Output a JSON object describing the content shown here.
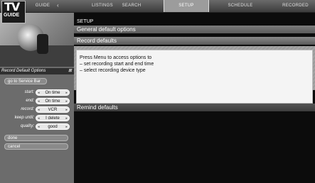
{
  "brand": {
    "logo_top": "TV",
    "logo_bottom": "GUIDE"
  },
  "nav": {
    "items": [
      {
        "label": "Guide"
      },
      {
        "label": "Listings"
      },
      {
        "label": "Search"
      },
      {
        "label": "Setup"
      },
      {
        "label": "Schedule"
      },
      {
        "label": "Recorded"
      }
    ],
    "active": "Setup"
  },
  "preview": {
    "channel_indicator": ""
  },
  "side_panel": {
    "title": "Record Default Options",
    "service_bar_button": "go to Service Bar",
    "options": [
      {
        "label": "start:",
        "value": "On time"
      },
      {
        "label": "end:",
        "value": "On time"
      },
      {
        "label": "record:",
        "value": "VCR"
      },
      {
        "label": "keep until:",
        "value": "I delete"
      },
      {
        "label": "quality:",
        "value": "good"
      }
    ],
    "done_button": "done",
    "cancel_button": "cancel"
  },
  "main": {
    "breadcrumb": "SETUP",
    "general_header": "General default options",
    "record_header": "Record defaults",
    "info": [
      "Press Menu to access options to",
      "– set recording start and end time",
      "– select recording device type"
    ],
    "remind_header": "Remind defaults"
  }
}
